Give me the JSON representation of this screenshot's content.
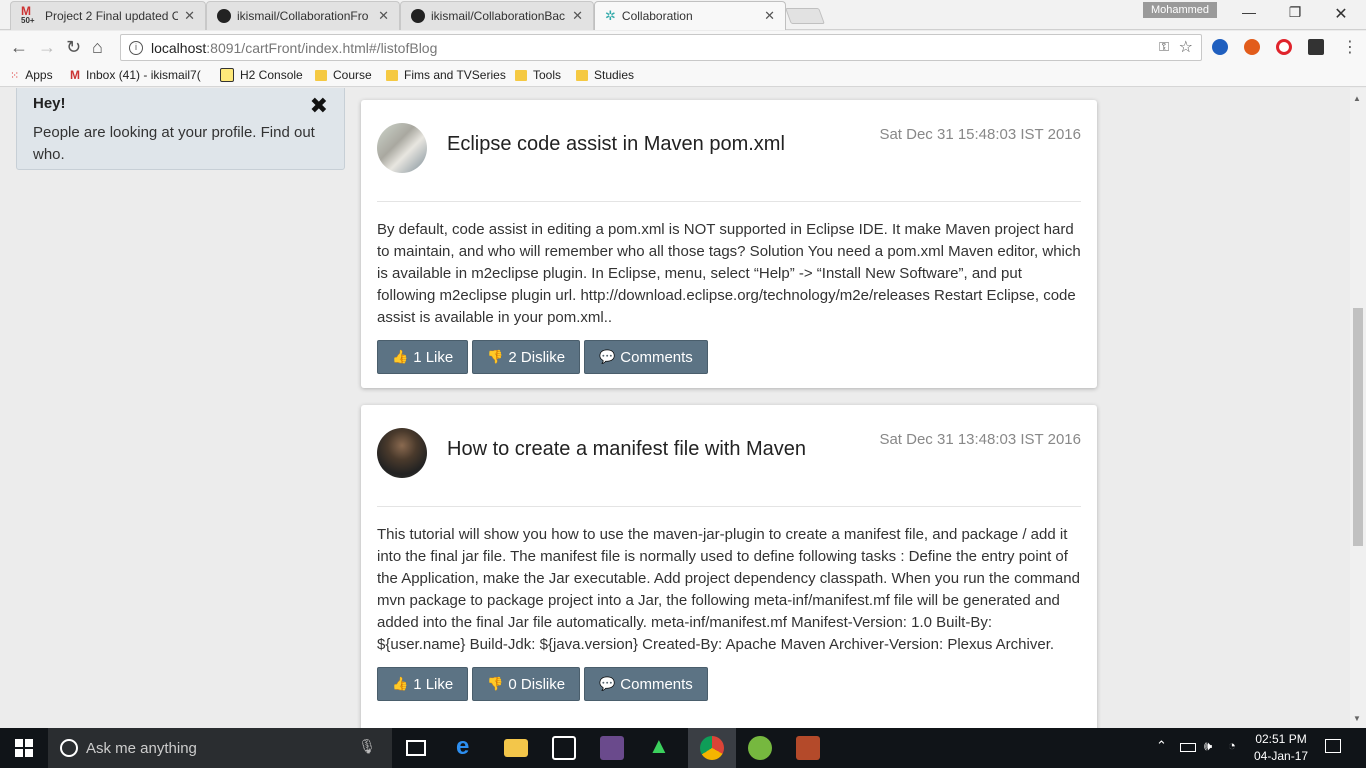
{
  "browser": {
    "tabs": [
      {
        "label": "Project 2 Final updated C",
        "badge": "50+"
      },
      {
        "label": "ikismail/CollaborationFro"
      },
      {
        "label": "ikismail/CollaborationBac"
      },
      {
        "label": "Collaboration"
      }
    ],
    "profile_name": "Mohammed",
    "url_host": "localhost",
    "url_rest": ":8091/cartFront/index.html#/listofBlog"
  },
  "bookmarks": [
    {
      "label": "Apps"
    },
    {
      "label": "Inbox (41) - ikismail7("
    },
    {
      "label": "H2 Console"
    },
    {
      "label": "Course"
    },
    {
      "label": "Fims and TVSeries"
    },
    {
      "label": "Tools"
    },
    {
      "label": "Studies"
    }
  ],
  "notice": {
    "title": "Hey!",
    "text": "People are looking at your profile. Find out who.",
    "close": "✖"
  },
  "posts": [
    {
      "title": "Eclipse code assist in Maven pom.xml",
      "date": "Sat Dec 31 15:48:03 IST 2016",
      "body": "By default, code assist in editing a pom.xml is NOT supported in Eclipse IDE. It make Maven project hard to maintain, and who will remember who all those tags? Solution You need a pom.xml Maven editor, which is available in m2eclipse plugin. In Eclipse, menu, select “Help” -> “Install New Software”, and put following m2eclipse plugin url. http://download.eclipse.org/technology/m2e/releases Restart Eclipse, code assist is available in your pom.xml..",
      "like": "1 Like",
      "dislike": "2 Dislike",
      "comments": "Comments"
    },
    {
      "title": "How to create a manifest file with Maven",
      "date": "Sat Dec 31 13:48:03 IST 2016",
      "body": "This tutorial will show you how to use the maven-jar-plugin to create a manifest file, and package / add it into the final jar file. The manifest file is normally used to define following tasks : Define the entry point of the Application, make the Jar executable. Add project dependency classpath. When you run the command mvn package to package project into a Jar, the following meta-inf/manifest.mf file will be generated and added into the final Jar file automatically. meta-inf/manifest.mf Manifest-Version: 1.0 Built-By: ${user.name} Build-Jdk: ${java.version} Created-By: Apache Maven Archiver-Version: Plexus Archiver.",
      "like": "1 Like",
      "dislike": "0 Dislike",
      "comments": "Comments"
    }
  ],
  "taskbar": {
    "search_placeholder": "Ask me anything",
    "time": "02:51 PM",
    "date": "04-Jan-17"
  }
}
